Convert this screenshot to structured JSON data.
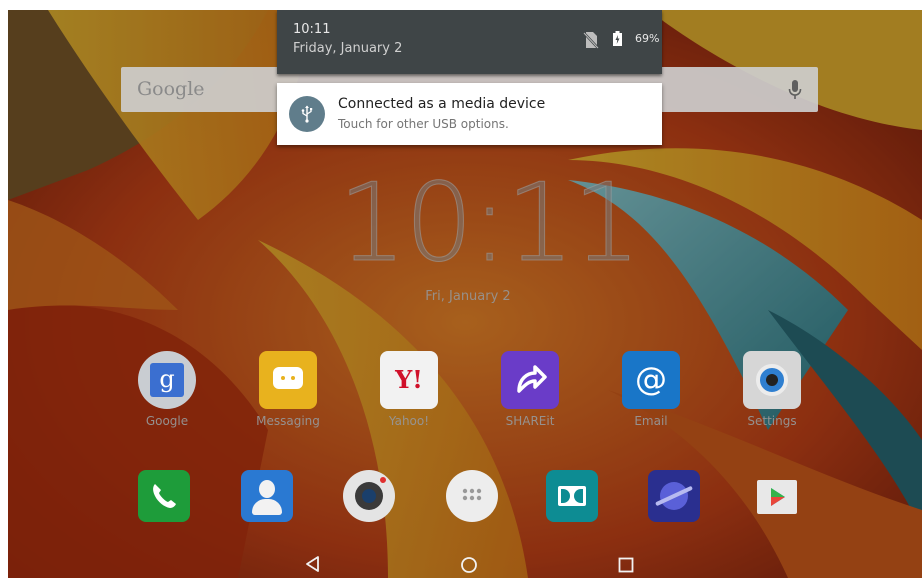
{
  "status_bar": {
    "time": "10:11",
    "date": "Friday, January 2",
    "battery_percent": "69%",
    "battery_level": 69,
    "icons": [
      "no-sim-icon",
      "battery-charging-icon"
    ]
  },
  "notification": {
    "icon": "usb-icon",
    "title": "Connected as a media device",
    "subtitle": "Touch for other USB options."
  },
  "search": {
    "logo_text": "Google",
    "icon": "mic-icon"
  },
  "clock": {
    "time": "10:11",
    "date": "Fri, January 2"
  },
  "apps": [
    {
      "label": "Google",
      "icon": "google-search-app-icon"
    },
    {
      "label": "Messaging",
      "icon": "messaging-app-icon"
    },
    {
      "label": "Yahoo!",
      "icon": "yahoo-app-icon"
    },
    {
      "label": "SHAREit",
      "icon": "shareit-app-icon"
    },
    {
      "label": "Email",
      "icon": "email-app-icon"
    },
    {
      "label": "Settings",
      "icon": "settings-app-icon"
    }
  ],
  "dock": [
    {
      "icon": "phone-app-icon"
    },
    {
      "icon": "contacts-app-icon"
    },
    {
      "icon": "camera-app-icon"
    },
    {
      "icon": "app-drawer-icon"
    },
    {
      "icon": "dolby-app-icon"
    },
    {
      "icon": "browser-app-icon"
    },
    {
      "icon": "play-store-app-icon"
    }
  ],
  "nav": {
    "icons": [
      "back-icon",
      "home-icon",
      "recents-icon"
    ]
  },
  "colors": {
    "shade_background": "#3f4547",
    "usb_icon_circle": "#607d8b",
    "notification_card": "#ffffff"
  }
}
